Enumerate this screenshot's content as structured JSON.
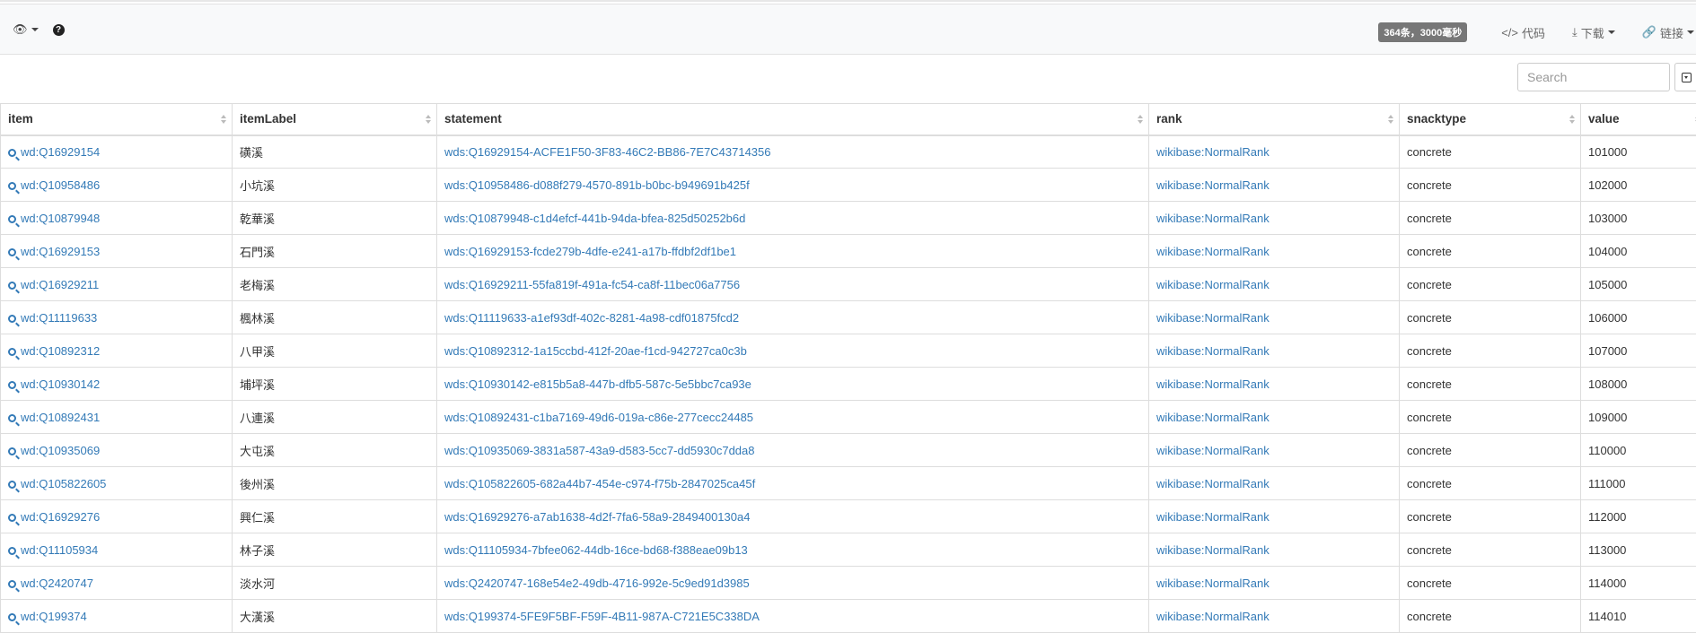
{
  "toolbar": {
    "eye_icon": "👁",
    "help_icon": "?",
    "badge": "364条，3000毫秒",
    "code_icon": "</>",
    "code_label": "代码",
    "download_icon": "⤓",
    "download_label": "下载",
    "link_icon": "🔗",
    "link_label": "链接"
  },
  "search": {
    "placeholder": "Search",
    "value": ""
  },
  "table": {
    "columns": [
      "item",
      "itemLabel",
      "statement",
      "rank",
      "snacktype",
      "value"
    ],
    "rows": [
      {
        "item": "wd:Q16929154",
        "itemLabel": "磺溪",
        "statement": "wds:Q16929154-ACFE1F50-3F83-46C2-BB86-7E7C43714356",
        "rank": "wikibase:NormalRank",
        "snacktype": "concrete",
        "value": "101000"
      },
      {
        "item": "wd:Q10958486",
        "itemLabel": "小坑溪",
        "statement": "wds:Q10958486-d088f279-4570-891b-b0bc-b949691b425f",
        "rank": "wikibase:NormalRank",
        "snacktype": "concrete",
        "value": "102000"
      },
      {
        "item": "wd:Q10879948",
        "itemLabel": "乾華溪",
        "statement": "wds:Q10879948-c1d4efcf-441b-94da-bfea-825d50252b6d",
        "rank": "wikibase:NormalRank",
        "snacktype": "concrete",
        "value": "103000"
      },
      {
        "item": "wd:Q16929153",
        "itemLabel": "石門溪",
        "statement": "wds:Q16929153-fcde279b-4dfe-e241-a17b-ffdbf2df1be1",
        "rank": "wikibase:NormalRank",
        "snacktype": "concrete",
        "value": "104000"
      },
      {
        "item": "wd:Q16929211",
        "itemLabel": "老梅溪",
        "statement": "wds:Q16929211-55fa819f-491a-fc54-ca8f-11bec06a7756",
        "rank": "wikibase:NormalRank",
        "snacktype": "concrete",
        "value": "105000"
      },
      {
        "item": "wd:Q11119633",
        "itemLabel": "楓林溪",
        "statement": "wds:Q11119633-a1ef93df-402c-8281-4a98-cdf01875fcd2",
        "rank": "wikibase:NormalRank",
        "snacktype": "concrete",
        "value": "106000"
      },
      {
        "item": "wd:Q10892312",
        "itemLabel": "八甲溪",
        "statement": "wds:Q10892312-1a15ccbd-412f-20ae-f1cd-942727ca0c3b",
        "rank": "wikibase:NormalRank",
        "snacktype": "concrete",
        "value": "107000"
      },
      {
        "item": "wd:Q10930142",
        "itemLabel": "埔坪溪",
        "statement": "wds:Q10930142-e815b5a8-447b-dfb5-587c-5e5bbc7ca93e",
        "rank": "wikibase:NormalRank",
        "snacktype": "concrete",
        "value": "108000"
      },
      {
        "item": "wd:Q10892431",
        "itemLabel": "八連溪",
        "statement": "wds:Q10892431-c1ba7169-49d6-019a-c86e-277cecc24485",
        "rank": "wikibase:NormalRank",
        "snacktype": "concrete",
        "value": "109000"
      },
      {
        "item": "wd:Q10935069",
        "itemLabel": "大屯溪",
        "statement": "wds:Q10935069-3831a587-43a9-d583-5cc7-dd5930c7dda8",
        "rank": "wikibase:NormalRank",
        "snacktype": "concrete",
        "value": "110000"
      },
      {
        "item": "wd:Q105822605",
        "itemLabel": "後州溪",
        "statement": "wds:Q105822605-682a44b7-454e-c974-f75b-2847025ca45f",
        "rank": "wikibase:NormalRank",
        "snacktype": "concrete",
        "value": "111000"
      },
      {
        "item": "wd:Q16929276",
        "itemLabel": "興仁溪",
        "statement": "wds:Q16929276-a7ab1638-4d2f-7fa6-58a9-2849400130a4",
        "rank": "wikibase:NormalRank",
        "snacktype": "concrete",
        "value": "112000"
      },
      {
        "item": "wd:Q11105934",
        "itemLabel": "林子溪",
        "statement": "wds:Q11105934-7bfee062-44db-16ce-bd68-f388eae09b13",
        "rank": "wikibase:NormalRank",
        "snacktype": "concrete",
        "value": "113000"
      },
      {
        "item": "wd:Q2420747",
        "itemLabel": "淡水河",
        "statement": "wds:Q2420747-168e54e2-49db-4716-992e-5c9ed91d3985",
        "rank": "wikibase:NormalRank",
        "snacktype": "concrete",
        "value": "114000"
      },
      {
        "item": "wd:Q199374",
        "itemLabel": "大漢溪",
        "statement": "wds:Q199374-5FE9F5BF-F59F-4B11-987A-C721E5C338DA",
        "rank": "wikibase:NormalRank",
        "snacktype": "concrete",
        "value": "114010"
      }
    ]
  }
}
